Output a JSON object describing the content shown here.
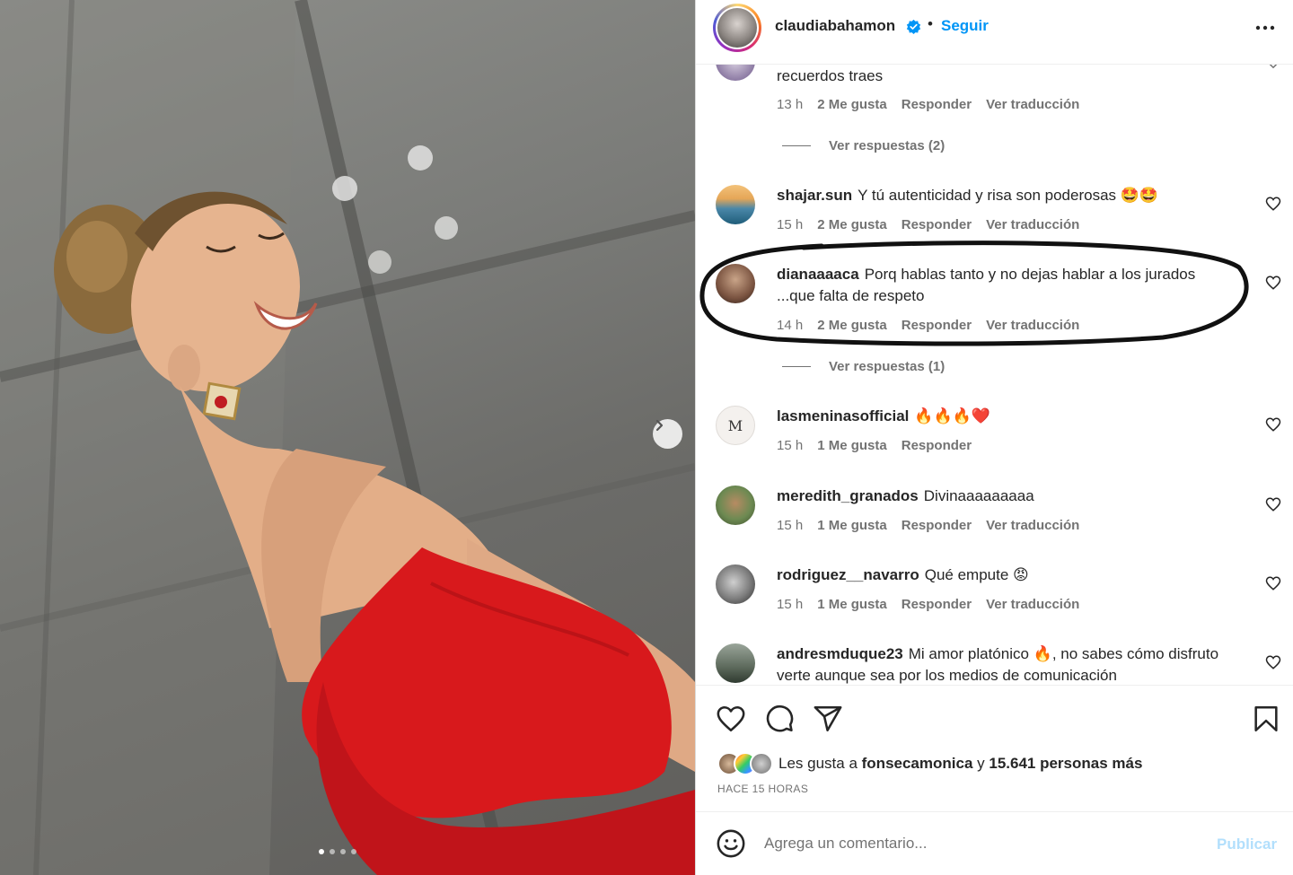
{
  "post": {
    "username": "claudiabahamon",
    "separator": "•",
    "follow_label": "Seguir"
  },
  "comments": [
    {
      "text": "recuerdos traes",
      "time": "13 h",
      "likes": "2 Me gusta",
      "reply": "Responder",
      "translate": "Ver traducción",
      "view_replies": "Ver respuestas (2)"
    },
    {
      "user": "shajar.sun",
      "text": "Y tú autenticidad y risa son poderosas 🤩🤩",
      "time": "15 h",
      "likes": "2 Me gusta",
      "reply": "Responder",
      "translate": "Ver traducción"
    },
    {
      "user": "dianaaaaca",
      "text": "Porq hablas tanto y no dejas hablar a los jurados ...que falta de respeto",
      "time": "14 h",
      "likes": "2 Me gusta",
      "reply": "Responder",
      "translate": "Ver traducción",
      "view_replies": "Ver respuestas (1)"
    },
    {
      "user": "lasmeninasofficial",
      "text": "🔥🔥🔥❤️",
      "time": "15 h",
      "likes": "1 Me gusta",
      "reply": "Responder"
    },
    {
      "user": "meredith_granados",
      "text": "Divinaaaaaaaaa",
      "time": "15 h",
      "likes": "1 Me gusta",
      "reply": "Responder",
      "translate": "Ver traducción"
    },
    {
      "user": "rodriguez__navarro",
      "text": "Qué empute 😡",
      "time": "15 h",
      "likes": "1 Me gusta",
      "reply": "Responder",
      "translate": "Ver traducción"
    },
    {
      "user": "andresmduque23",
      "text": "Mi amor platónico 🔥, no sabes cómo disfruto verte aunque sea por los medios de comunicación"
    }
  ],
  "likes_summary": {
    "prefix": "Les gusta a",
    "user": "fonsecamonica",
    "connector": "y",
    "others": "15.641 personas más"
  },
  "time_ago": "HACE 15 HORAS",
  "composer": {
    "placeholder": "Agrega un comentario...",
    "publish_label": "Publicar"
  },
  "colors": {
    "accent": "#0095f6",
    "publish_disabled": "#b2dffc",
    "dress": "#d8191c"
  }
}
